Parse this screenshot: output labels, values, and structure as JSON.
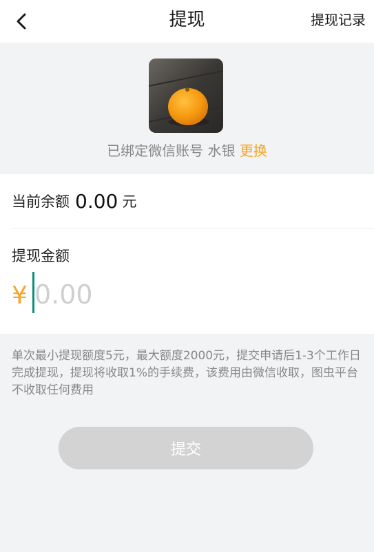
{
  "header": {
    "title": "提现",
    "record_link": "提现记录"
  },
  "account": {
    "bound_text": "已绑定微信账号 水银",
    "change_link": "更换"
  },
  "balance": {
    "label": "当前余额",
    "value": "0.00",
    "unit": "元"
  },
  "withdraw": {
    "label": "提现金额",
    "currency_symbol": "¥",
    "placeholder": "0.00",
    "value": ""
  },
  "notice": "单次最小提现额度5元，最大额度2000元，提交申请后1-3个工作日完成提现，提现将收取1%的手续费，该费用由微信收取，图虫平台不收取任何费用",
  "submit_label": "提交",
  "colors": {
    "accent": "#f5a623",
    "caret": "#0e8c7a",
    "button_disabled": "#d3d3d3"
  }
}
